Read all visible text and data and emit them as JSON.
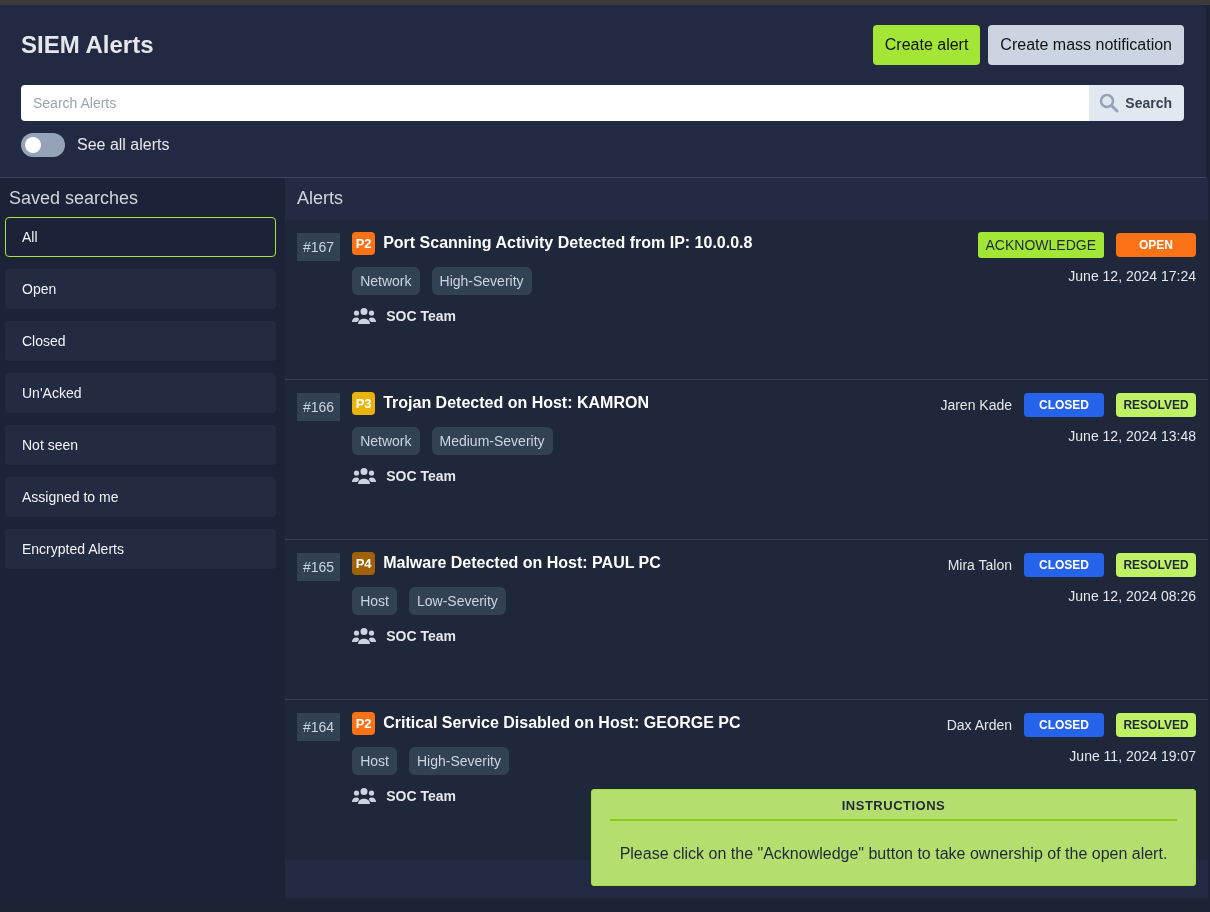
{
  "header": {
    "title": "SIEM Alerts",
    "buttons": [
      {
        "label": "Create alert",
        "kind": "primary"
      },
      {
        "label": "Create mass notification",
        "kind": "secondary"
      }
    ],
    "search": {
      "placeholder": "Search Alerts",
      "button": "Search"
    },
    "toggle": {
      "label": "See all alerts",
      "on": false
    }
  },
  "sidebar": {
    "title": "Saved searches",
    "items": [
      {
        "label": "All",
        "selected": true
      },
      {
        "label": "Open",
        "selected": false
      },
      {
        "label": "Closed",
        "selected": false
      },
      {
        "label": "Un'Acked",
        "selected": false
      },
      {
        "label": "Not seen",
        "selected": false
      },
      {
        "label": "Assigned to me",
        "selected": false
      },
      {
        "label": "Encrypted Alerts",
        "selected": false
      }
    ]
  },
  "alerts": {
    "title": "Alerts",
    "items": [
      {
        "id": "#167",
        "priority": "P2",
        "color": "#f97316",
        "title": "Port Scanning Activity Detected from IP: 10.0.0.8",
        "tags": [
          "Network",
          "High-Severity"
        ],
        "team": "SOC Team",
        "action": "ACKNOWLEDGE",
        "badges": [
          {
            "label": "OPEN",
            "kind": "open"
          }
        ],
        "time": "June 12, 2024 17:24"
      },
      {
        "id": "#166",
        "priority": "P3",
        "color": "#eab308",
        "title": "Trojan Detected on Host: KAMRON",
        "tags": [
          "Network",
          "Medium-Severity"
        ],
        "team": "SOC Team",
        "assignee": "Jaren Kade",
        "badges": [
          {
            "label": "CLOSED",
            "kind": "closed"
          },
          {
            "label": "RESOLVED",
            "kind": "resolved"
          }
        ],
        "time": "June 12, 2024 13:48"
      },
      {
        "id": "#165",
        "priority": "P4",
        "color": "#a16207",
        "title": "Malware Detected on Host: PAUL PC",
        "tags": [
          "Host",
          "Low-Severity"
        ],
        "team": "SOC Team",
        "assignee": "Mira Talon",
        "badges": [
          {
            "label": "CLOSED",
            "kind": "closed"
          },
          {
            "label": "RESOLVED",
            "kind": "resolved"
          }
        ],
        "time": "June 12, 2024 08:26"
      },
      {
        "id": "#164",
        "priority": "P2",
        "color": "#f97316",
        "title": "Critical Service Disabled on Host: GEORGE PC",
        "tags": [
          "Host",
          "High-Severity"
        ],
        "team": "SOC Team",
        "assignee": "Dax Arden",
        "badges": [
          {
            "label": "CLOSED",
            "kind": "closed"
          },
          {
            "label": "RESOLVED",
            "kind": "resolved"
          }
        ],
        "time": "June 11, 2024 19:07"
      }
    ]
  },
  "instructions": {
    "title": "INSTRUCTIONS",
    "text": "Please click on the \"Acknowledge\" button to take ownership of the open alert."
  }
}
